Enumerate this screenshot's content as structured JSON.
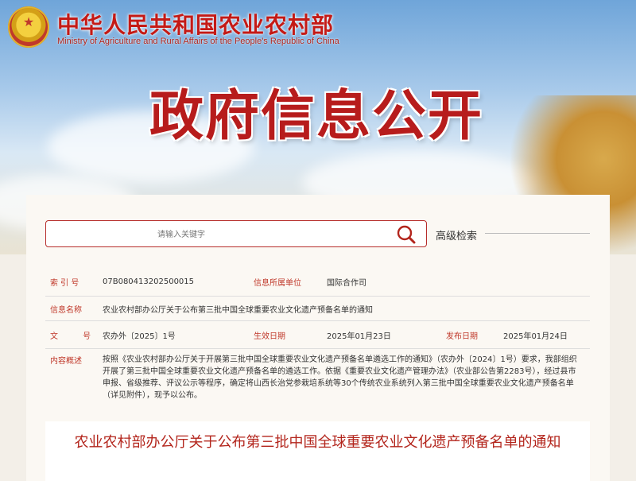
{
  "header": {
    "ministry_cn": "中华人民共和国农业农村部",
    "ministry_en": "Ministry of Agriculture and Rural Affairs of the People's Republic of China",
    "headline": "政府信息公开"
  },
  "search": {
    "placeholder": "请输入关键字",
    "advanced_label": "高级检索"
  },
  "info": {
    "index_label": "索 引 号",
    "index_value": "07B080413202500015",
    "unit_label": "信息所属单位",
    "unit_value": "国际合作司",
    "name_label": "信息名称",
    "name_value": "农业农村部办公厅关于公布第三批中国全球重要农业文化遗产预备名单的通知",
    "docno_label": "文 号",
    "docno_value": "农办外〔2025〕1号",
    "effective_label": "生效日期",
    "effective_value": "2025年01月23日",
    "publish_label": "发布日期",
    "publish_value": "2025年01月24日",
    "summary_label": "内容概述",
    "summary_value": "按照《农业农村部办公厅关于开展第三批中国全球重要农业文化遗产预备名单遴选工作的通知》（农办外〔2024〕1号）要求，我部组织开展了第三批中国全球重要农业文化遗产预备名单的遴选工作。依据《重要农业文化遗产管理办法》（农业部公告第2283号），经过县市申报、省级推荐、评议公示等程序，确定将山西长治党参栽培系统等30个传统农业系统列入第三批中国全球重要农业文化遗产预备名单（详见附件），现予以公布。"
  },
  "document": {
    "title": "农业农村部办公厅关于公布第三批中国全球重要农业文化遗产预备名单的通知"
  },
  "colors": {
    "accent_red": "#b3251c",
    "label_red": "#c0392b"
  },
  "icons": {
    "search": "search-icon",
    "emblem": "national-emblem-icon"
  }
}
